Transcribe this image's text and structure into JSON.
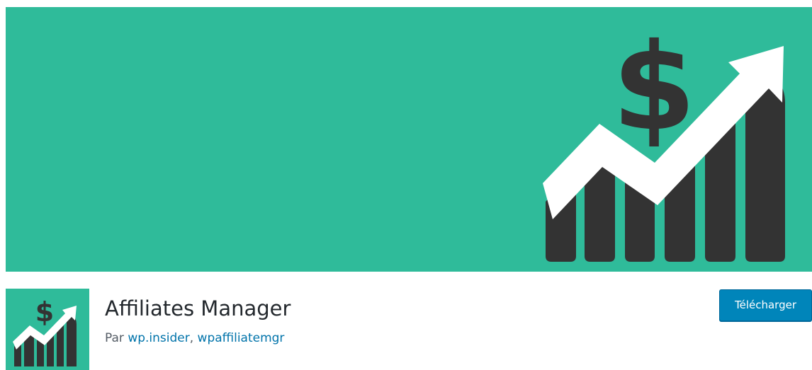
{
  "plugin": {
    "name": "Affiliates Manager",
    "author_prefix": "Par",
    "authors": [
      "wp.insider",
      "wpaffiliatemgr"
    ],
    "author_separator": ", ",
    "download_label": "Télécharger"
  },
  "banner": {
    "graphic_icon": "dollar-growth-chart-icon",
    "dollar_symbol": "$"
  },
  "colors": {
    "banner_bg": "#2fbb9a",
    "graphic_dark": "#333333",
    "arrow": "#ffffff",
    "link": "#0073aa",
    "title": "#23282d",
    "button_bg": "#0085ba"
  }
}
